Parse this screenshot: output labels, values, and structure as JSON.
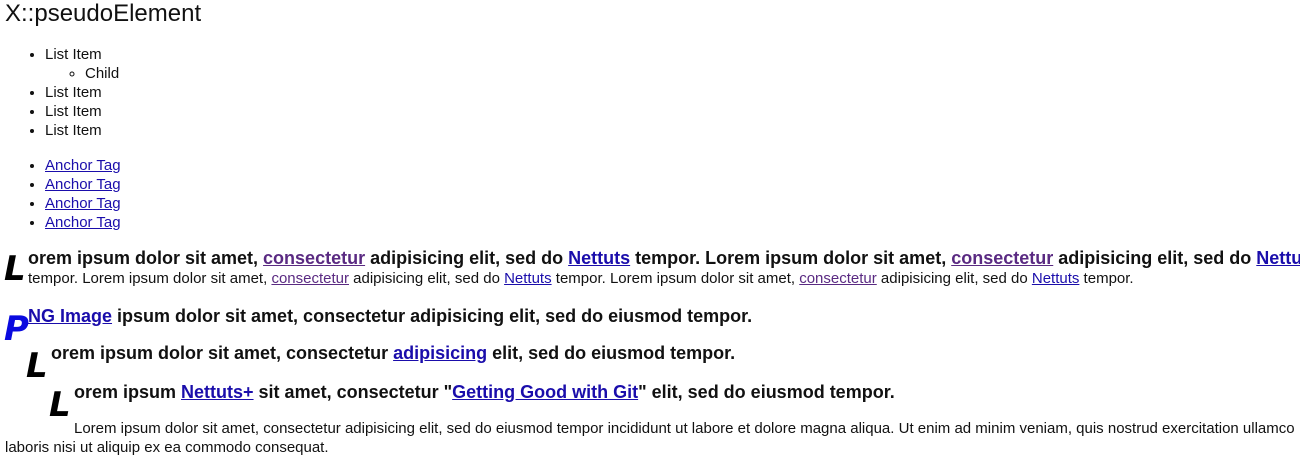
{
  "title": "X::pseudoElement",
  "list_a": {
    "items": [
      {
        "label": "List Item",
        "children": [
          "Child"
        ]
      },
      {
        "label": "List Item"
      },
      {
        "label": "List Item"
      },
      {
        "label": "List Item"
      }
    ]
  },
  "list_b": {
    "links": [
      "Anchor Tag",
      "Anchor Tag",
      "Anchor Tag",
      "Anchor Tag"
    ]
  },
  "p1": {
    "drop": "L",
    "lead": {
      "t1": "orem ipsum dolor sit amet, ",
      "a1": "consectetur",
      "t2": " adipisicing elit, sed do ",
      "a2": "Nettuts",
      "t3": " tempor. Lorem ipsum dolor sit amet, ",
      "a3": "consectetur",
      "t4": " adipisicing elit, sed do ",
      "a4": "Nettuts"
    },
    "rest": {
      "t1": "tempor. Lorem ipsum dolor sit amet, ",
      "a1": "consectetur",
      "t2": " adipisicing elit, sed do ",
      "a2": "Nettuts",
      "t3": " tempor. Lorem ipsum dolor sit amet, ",
      "a3": "consectetur",
      "t4": " adipisicing elit, sed do ",
      "a4": "Nettuts",
      "t5": " tempor."
    }
  },
  "p2": {
    "drop": "P",
    "link": "NG Image",
    "text": " ipsum dolor sit amet, consectetur adipisicing elit, sed do eiusmod tempor."
  },
  "p3": {
    "drop": "L",
    "t1": "orem ipsum dolor sit amet, consectetur ",
    "link": "adipisicing",
    "t2": " elit, sed do eiusmod tempor."
  },
  "p4": {
    "drop": "L",
    "t1": "orem ipsum ",
    "link1": "Nettuts+",
    "t2": " sit amet, consectetur \"",
    "link2": "Getting Good with Git",
    "t3": "\" elit, sed do eiusmod tempor."
  },
  "p5": {
    "text": "Lorem ipsum dolor sit amet, consectetur adipisicing elit, sed do eiusmod tempor incididunt ut labore et dolore magna aliqua. Ut enim ad minim veniam, quis nostrud exercitation ullamco laboris nisi ut aliquip ex ea commodo consequat."
  }
}
